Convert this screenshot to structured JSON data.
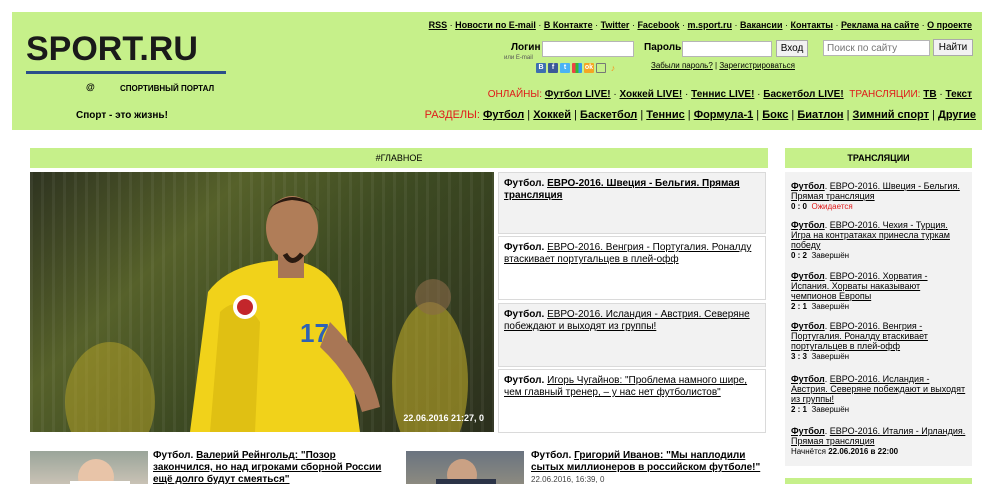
{
  "toplinks": [
    "RSS",
    "Новости по E-mail",
    "В Контакте",
    "Twitter",
    "Facebook",
    "m.sport.ru",
    "Вакансии",
    "Контакты",
    "Реклама на сайте",
    "О проекте"
  ],
  "logo": {
    "brand": "SPORT.RU",
    "at": "@",
    "subtitle": "СПОРТИВНЫЙ ПОРТАЛ",
    "rule_color": "#2a4f8a"
  },
  "login": {
    "login_label": "Логин",
    "or_email": "или E-mail",
    "password_label": "Пароль",
    "enter_button": "Вход",
    "search_placeholder": "Поиск по сайту",
    "search_button": "Найти",
    "forgot": "Забыли пароль?",
    "divider": "|",
    "register": "Зарегистрироваться"
  },
  "social_icons": [
    "blogger-icon",
    "facebook-icon",
    "twitter-icon",
    "google-icon",
    "odnoklassniki-icon",
    "lock-icon",
    "rss-icon"
  ],
  "online": {
    "label": "ОНЛАЙНЫ:",
    "items": [
      "Футбол LIVE!",
      "Хоккей LIVE!",
      "Теннис LIVE!",
      "Баскетбол LIVE!"
    ],
    "broadcasts_label": "ТРАНСЛЯЦИИ:",
    "broadcast_items": [
      "ТВ",
      "Текст"
    ]
  },
  "slogan": "Спорт - это жизнь!",
  "sections": {
    "label": "РАЗДЕЛЫ:",
    "items": [
      "Футбол",
      "Хоккей",
      "Баскетбол",
      "Теннис",
      "Формула-1",
      "Бокс",
      "Биатлон",
      "Зимний спорт",
      "Другие"
    ]
  },
  "main_head": "#ГЛАВНОЕ",
  "side_head": "ТРАНСЛЯЦИИ",
  "hero": {
    "date": "22.06.2016 21:27, 0"
  },
  "stories": [
    {
      "cat": "Футбол.",
      "title": "ЕВРО-2016. Швеция - Бельгия. Прямая трансляция",
      "bold": true
    },
    {
      "cat": "Футбол.",
      "title": "ЕВРО-2016. Венгрия - Португалия. Роналду втаскивает португальцев в плей-офф",
      "bold": false
    },
    {
      "cat": "Футбол.",
      "title": "ЕВРО-2016. Исландия - Австрия. Северяне побеждают и выходят из группы!",
      "bold": false
    },
    {
      "cat": "Футбол.",
      "title": "Игорь Чугайнов: \"Проблема намного шире, чем главный тренер, – у нас нет футболистов\"",
      "bold": false
    }
  ],
  "broadcasts": [
    {
      "cat": "Футбол",
      "title": "ЕВРО-2016. Швеция - Бельгия. Прямая трансляция",
      "score": "0 : 0",
      "status": "Ожидается"
    },
    {
      "cat": "Футбол",
      "title": "ЕВРО-2016. Чехия - Турция. Игра на контратаках принесла туркам победу",
      "score": "0 : 2",
      "status": "Завершён"
    },
    {
      "cat": "Футбол",
      "title": "ЕВРО-2016. Хорватия - Испания. Хорваты наказывают чемпионов Европы",
      "score": "2 : 1",
      "status": "Завершён"
    },
    {
      "cat": "Футбол",
      "title": "ЕВРО-2016. Венгрия - Португалия. Роналду втаскивает португальцев в плей-офф",
      "score": "3 : 3",
      "status": "Завершён"
    },
    {
      "cat": "Футбол",
      "title": "ЕВРО-2016. Исландия - Австрия. Северяне побеждают и выходят из группы!",
      "score": "2 : 1",
      "status": "Завершён"
    },
    {
      "cat": "Футбол",
      "title": "ЕВРО-2016. Италия - Ирландия. Прямая трансляция",
      "start_label": "Начнётся",
      "start_date": "22.06.2016 в 22:00"
    }
  ],
  "bottom": [
    {
      "cat": "Футбол.",
      "title": "Валерий Рейнгольд: \"Позор закончился, но над игроками сборной России ещё долго будут смеяться\""
    },
    {
      "cat": "Футбол.",
      "title": "Григорий Иванов: \"Мы наплодили сытых миллионеров в российском футболе!\"",
      "ts": "22.06.2016, 16:39, 0"
    }
  ],
  "colors": {
    "header_bg": "#c6f08a",
    "accent_red": "#e01919",
    "panel_bg": "#f2f2f2"
  }
}
